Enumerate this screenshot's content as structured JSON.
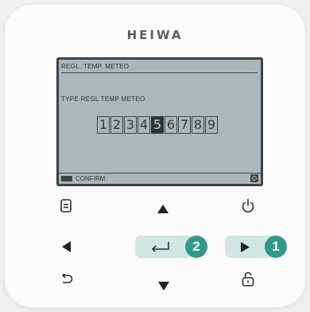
{
  "brand": "HEIWA",
  "screen": {
    "title": "REGL. TEMP. METEO",
    "label": "TYPE REGL TEMP METEO",
    "options": [
      "1",
      "2",
      "3",
      "4",
      "5",
      "6",
      "7",
      "8",
      "9"
    ],
    "selected": "5",
    "footer_label": "CONFIRM"
  },
  "callouts": {
    "confirm_step": "2",
    "right_step": "1"
  },
  "colors": {
    "lcd_background": "#acb7b8",
    "highlight_pill": "#cfe6e3",
    "badge": "#2f9a8c"
  },
  "icons": {
    "menu": "menu-icon",
    "power": "power-icon",
    "up": "up-arrow-icon",
    "down": "down-arrow-icon",
    "left": "left-arrow-icon",
    "right": "right-arrow-icon",
    "enter": "enter-icon",
    "back": "back-icon",
    "lock": "unlock-icon"
  }
}
